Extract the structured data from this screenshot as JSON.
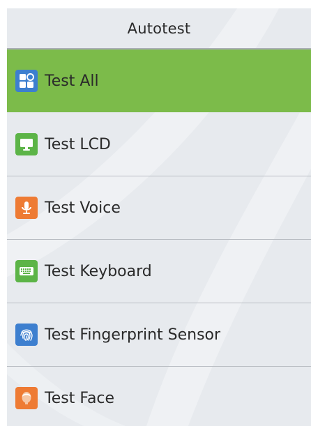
{
  "header": {
    "title": "Autotest"
  },
  "menu": {
    "items": [
      {
        "label": "Test All",
        "icon": "test-all-icon",
        "icon_color": "#3d7fcf",
        "selected": true
      },
      {
        "label": "Test LCD",
        "icon": "monitor-icon",
        "icon_color": "#5cb447",
        "selected": false
      },
      {
        "label": "Test Voice",
        "icon": "microphone-icon",
        "icon_color": "#ee7b34",
        "selected": false
      },
      {
        "label": "Test Keyboard",
        "icon": "keyboard-icon",
        "icon_color": "#5cb447",
        "selected": false
      },
      {
        "label": "Test Fingerprint Sensor",
        "icon": "fingerprint-icon",
        "icon_color": "#3d7fcf",
        "selected": false
      },
      {
        "label": "Test Face",
        "icon": "face-icon",
        "icon_color": "#ee7b34",
        "selected": false
      }
    ]
  },
  "colors": {
    "selected_background": "#7cbb4a",
    "panel_background": "#e7eaee"
  }
}
